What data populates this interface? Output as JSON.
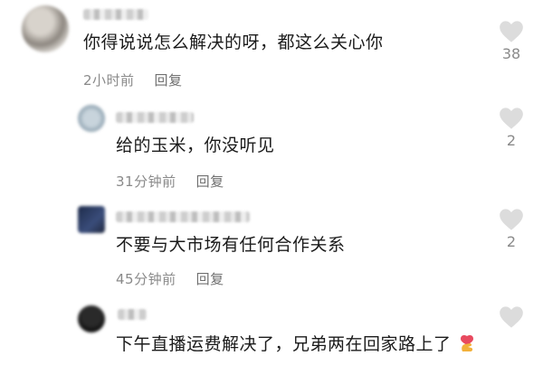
{
  "comments": [
    {
      "text": "你得说说怎么解决的呀，都这么关心你",
      "time": "2小时前",
      "reply": "回复",
      "likes": "38"
    },
    {
      "text": "给的玉米，你没听见",
      "time": "31分钟前",
      "reply": "回复",
      "likes": "2"
    },
    {
      "text": "不要与大市场有任何合作关系",
      "time": "45分钟前",
      "reply": "回复",
      "likes": "2"
    },
    {
      "text": "下午直播运费解决了，兄弟两在回家路上了",
      "likes": ""
    }
  ],
  "icons": {
    "like": "heart-icon",
    "emoji": "finger-heart-emoji-icon"
  },
  "colors": {
    "text": "#1b1b1b",
    "meta": "#8a8a8a",
    "heart": "#dcdcdc"
  }
}
